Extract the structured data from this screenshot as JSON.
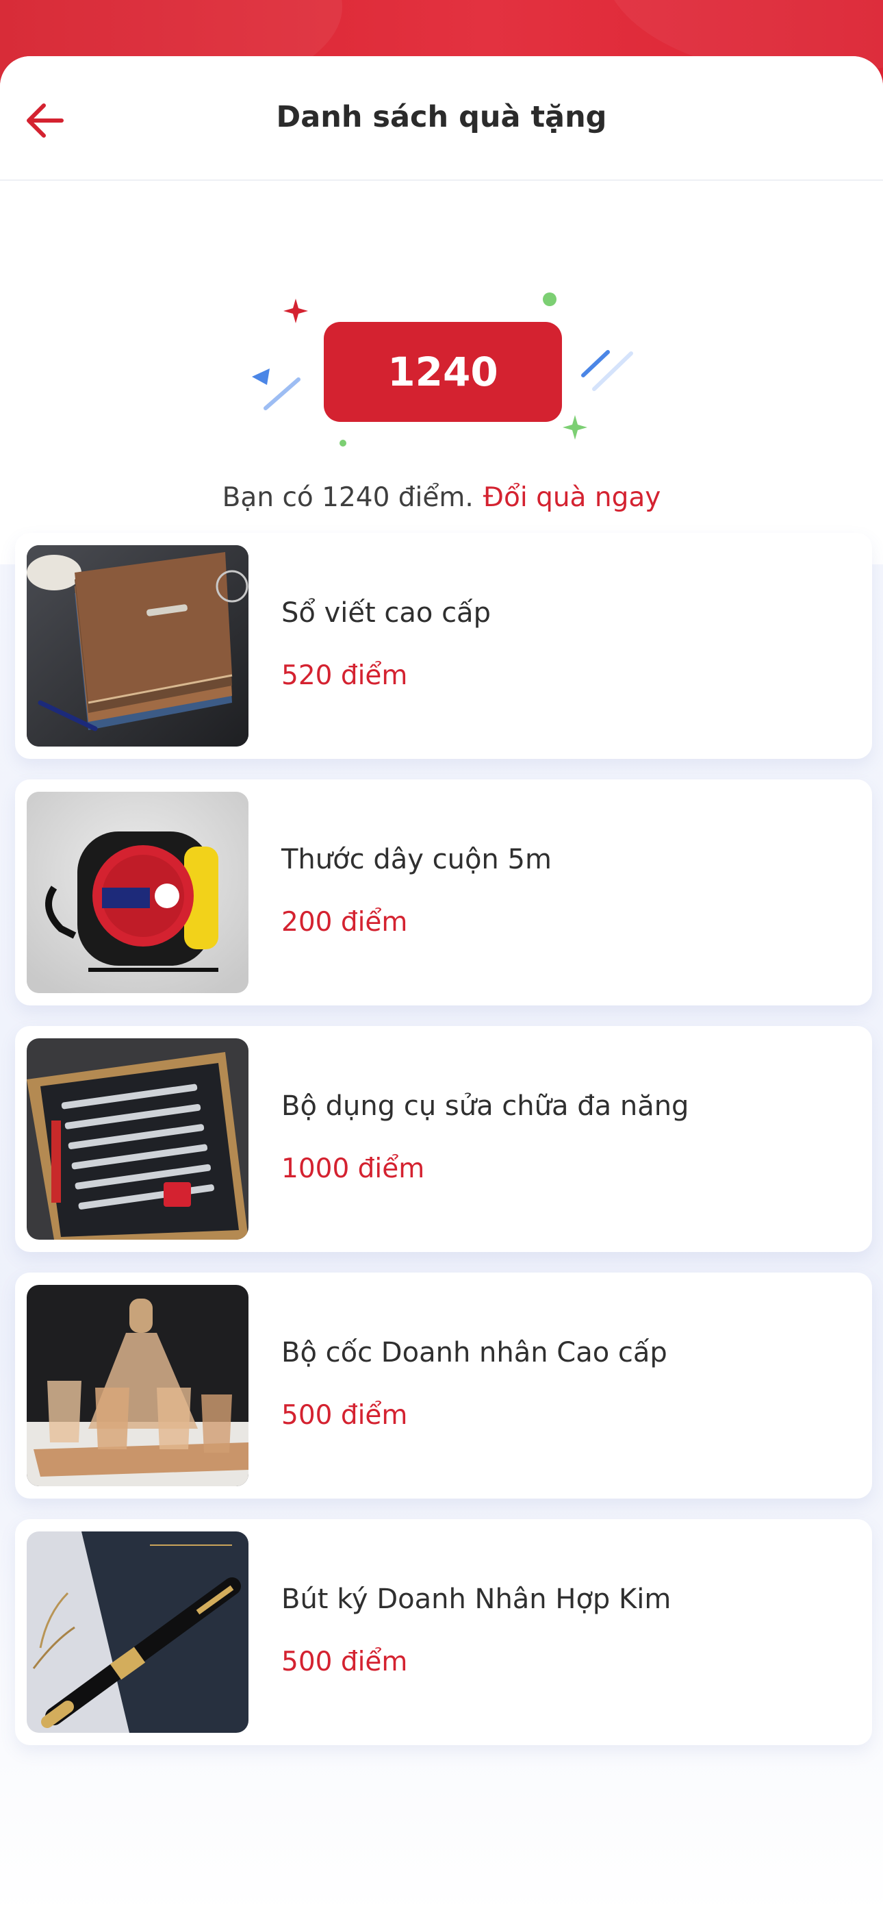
{
  "header": {
    "title": "Danh sách quà tặng"
  },
  "points": {
    "badge_value": "1240",
    "message": "Bạn có 1240 điểm.",
    "redeem_label": "Đổi quà ngay"
  },
  "colors": {
    "brand_red": "#d42230",
    "accent_green": "#7ccf73",
    "accent_blue": "#4b86e6"
  },
  "gifts": [
    {
      "name": "Sổ viết cao cấp",
      "points": "520 điểm",
      "image_icon": "notebook-image"
    },
    {
      "name": "Thước dây cuộn 5m",
      "points": "200 điểm",
      "image_icon": "tape-measure-image"
    },
    {
      "name": "Bộ dụng cụ sửa chữa đa năng",
      "points": "1000 điểm",
      "image_icon": "toolbox-image"
    },
    {
      "name": "Bộ cốc Doanh nhân Cao cấp",
      "points": "500 điểm",
      "image_icon": "glass-set-image"
    },
    {
      "name": "Bút ký Doanh Nhân Hợp Kim",
      "points": "500 điểm",
      "image_icon": "pen-image"
    }
  ]
}
